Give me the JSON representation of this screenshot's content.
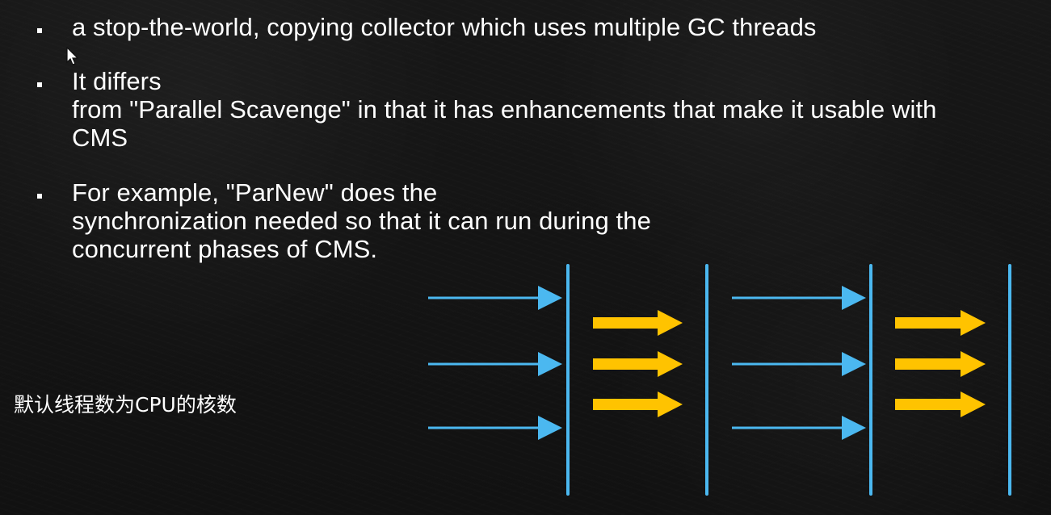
{
  "slide": {
    "bullets": [
      {
        "lines": [
          "a stop-the-world, copying collector which uses multiple GC threads"
        ]
      },
      {
        "lines": [
          "It differs",
          "from \"Parallel Scavenge\" in that it has enhancements that make it usable with",
          "CMS"
        ]
      },
      {
        "lines": [
          "For example, \"ParNew\" does the",
          "synchronization needed so that it can run during the",
          "concurrent phases of CMS."
        ]
      }
    ],
    "note": "默认线程数为CPU的核数"
  },
  "diagram": {
    "colors": {
      "blue": "#4bb8f0",
      "yellow": "#ffc300"
    }
  }
}
